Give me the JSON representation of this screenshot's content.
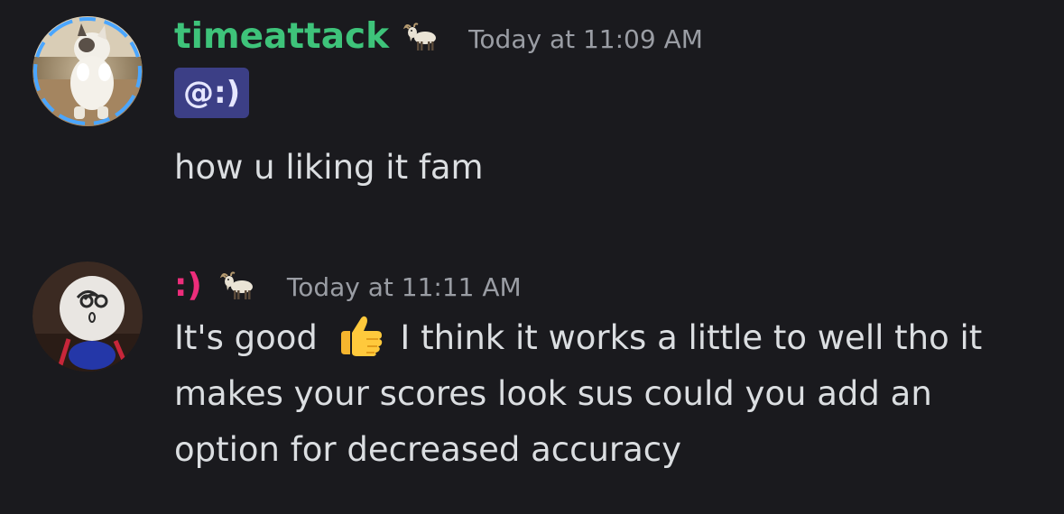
{
  "messages": [
    {
      "username": "timeattack",
      "badge_icon": "goat-icon",
      "timestamp": "Today at 11:09 AM",
      "mention": "@:)",
      "text": "how u liking it fam",
      "username_color": "#3ec37a"
    },
    {
      "username": ":)",
      "badge_icon": "goat-icon",
      "timestamp": "Today at 11:11 AM",
      "text_before_emoji": "It's good",
      "emoji": "thumbs-up-icon",
      "text_after_emoji": "I think it works a little to well tho it makes your scores look sus could you add an option for decreased accuracy",
      "username_color": "#ed2d7b"
    }
  ],
  "colors": {
    "background": "#1a1a1e",
    "text": "#dbdee1",
    "timestamp": "#9a9da4",
    "mention_bg": "#3c3f86"
  }
}
